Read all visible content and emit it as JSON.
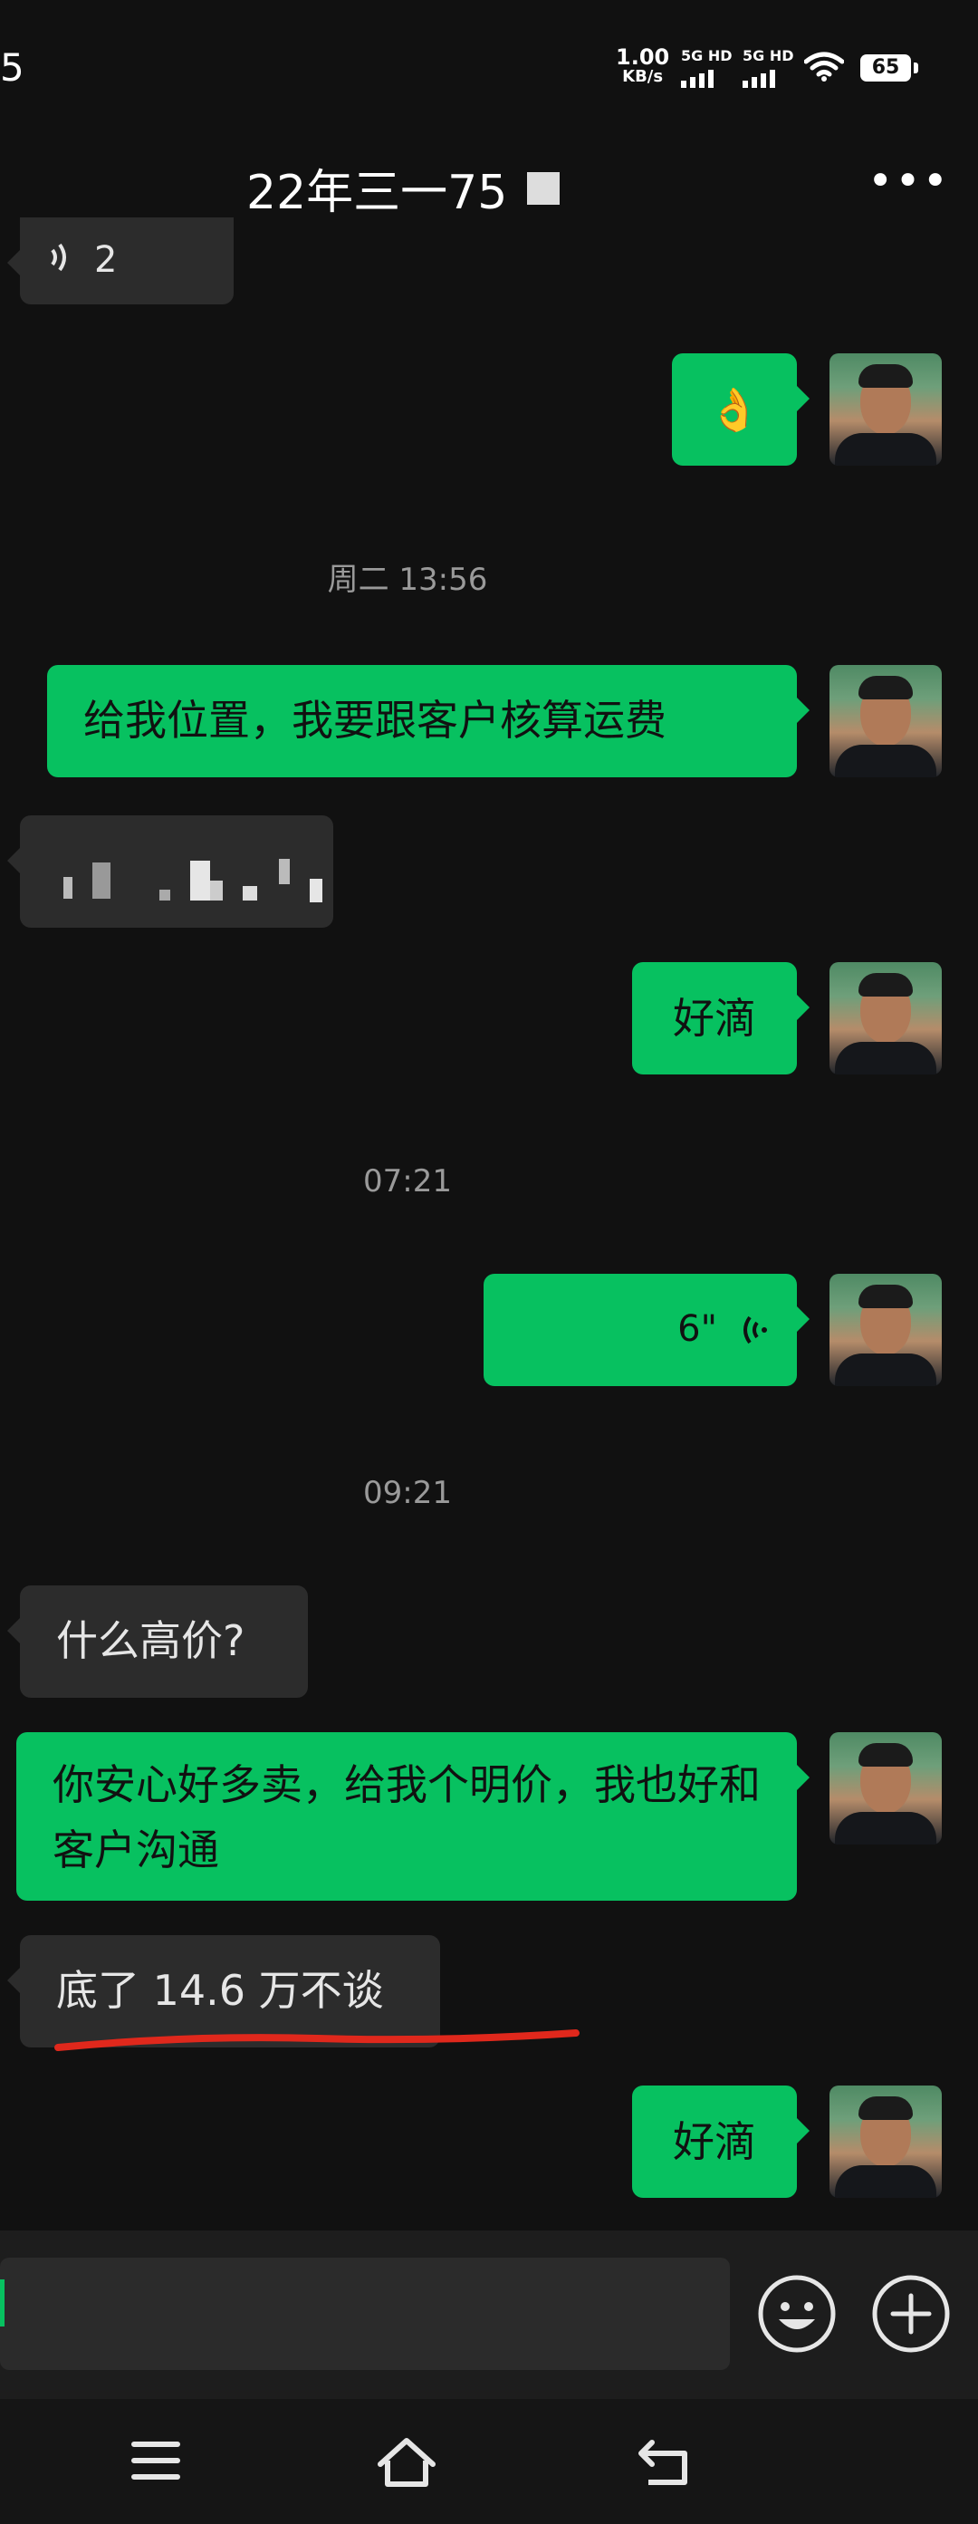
{
  "status_bar": {
    "time": "5",
    "network_speed_value": "1.00",
    "network_speed_unit": "KB/s",
    "sim1_label": "5G HD",
    "sim2_label": "5G HD",
    "battery": "65"
  },
  "header": {
    "title": "22年三一75"
  },
  "messages": {
    "m0_voice_duration": "2",
    "m1_emoji": "👌",
    "t1": "周二 13:56",
    "m2_text": "给我位置，我要跟客户核算运费",
    "m4_text": "好滴",
    "t2": "07:21",
    "m5_voice_duration": "6\"",
    "t3": "09:21",
    "m6_text": "什么高价?",
    "m7_text": "你安心好多卖，给我个明价，我也好和客户沟通",
    "m8_text": "底了 14.6 万不谈",
    "m9_text": "好滴"
  },
  "colors": {
    "sent_bubble": "#07c160",
    "received_bubble": "#2c2c2c",
    "background": "#111111",
    "annotation_underline": "#e0281c"
  }
}
